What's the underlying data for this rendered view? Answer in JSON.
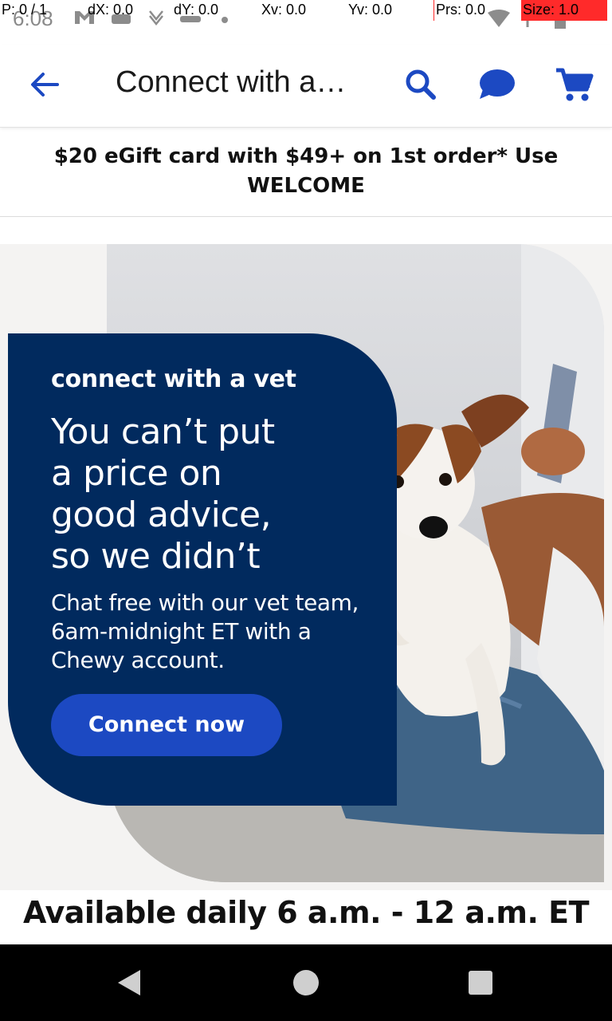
{
  "status_bar": {
    "time": "6:08",
    "overlay": {
      "p": "P: 0 / 1",
      "dx": "dX: 0.0",
      "dy": "dY: 0.0",
      "xv": "Xv: 0.0",
      "yv": "Yv: 0.0",
      "prs": "Prs: 0.0",
      "size": "Size: 1.0"
    }
  },
  "app_bar": {
    "title": "Connect with a…",
    "icons": [
      "back-arrow-icon",
      "search-icon",
      "chat-bubble-icon",
      "cart-icon"
    ],
    "accent": "#1c49c2"
  },
  "promo": {
    "line1": "$20 eGift card with $49+ on 1st order* Use",
    "line2": "WELCOME"
  },
  "hero": {
    "kicker": "connect with a vet",
    "headline": [
      "You can’t put",
      "a price on",
      "good advice,",
      "so we didn’t"
    ],
    "body": [
      "Chat free with our vet team,",
      "6am-midnight ET with a",
      "Chewy account."
    ],
    "cta": "Connect now",
    "card_color": "#012a5e"
  },
  "availability": "Available daily 6 a.m. - 12 a.m. ET",
  "nav_bar": {
    "icons": [
      "nav-back-icon",
      "nav-home-icon",
      "nav-recents-icon"
    ]
  }
}
